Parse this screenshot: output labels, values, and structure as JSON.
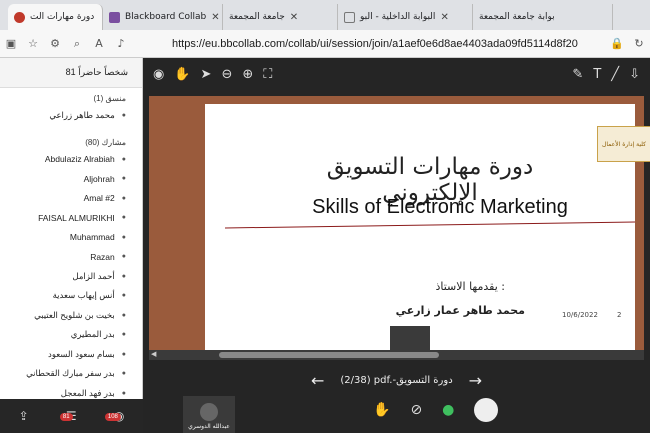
{
  "tabs": [
    {
      "label": "دورة مهارات الت",
      "active": true,
      "color": "#c0392b"
    },
    {
      "label": "Blackboard Collab",
      "active": false,
      "color": "#7b4fa0"
    },
    {
      "label": "جامعة المجمعة",
      "active": false,
      "color": "#2e7d32"
    },
    {
      "label": "البوابة الداخلية - البو",
      "active": false,
      "color": "#999"
    },
    {
      "label": "بوابة جامعة المجمعة",
      "active": false,
      "color": "#999"
    }
  ],
  "address": {
    "url": "https://eu.bbcollab.com/collab/ui/session/join/a1aef0e6d8ae4403ada09fd5114d8f20"
  },
  "sidebar": {
    "header": "81 شخصاً حاضراً",
    "moderator_label": "منسق (1)",
    "moderators": [
      "محمد طاهر زراعي"
    ],
    "participants_label": "مشارك (80)",
    "participants": [
      "Abdulaziz Alrabiah",
      "Aljohrah",
      "Amal #2",
      "FAISAL ALMURIKHI",
      "Muhammad",
      "Razan",
      "أحمد الزامل",
      "أنس إيهاب سعدية",
      "بخيت بن شلويح العتيبي",
      "بدر المطيري",
      "بسام سعود السعود",
      "بدر سفر مبارك القحطاني",
      "بدر فهد المعجل"
    ],
    "footer": {
      "chat_badge": "81",
      "people_badge": "108"
    }
  },
  "slide": {
    "title_ar": "دورة مهارات التسويق الإلكتروني",
    "title_en": "Skills of Electronic Marketing",
    "presenter_label": "يقدمها الاستاذ :",
    "presenter_name": "محمد طاهر عمار زارعي",
    "date": "10/6/2022",
    "page": "2",
    "logo_text": "كلية إدارة الأعمال"
  },
  "slide_nav": {
    "label": "(2/38)  pdf.-دورة التسويق"
  },
  "cam_name": "عبدالله الدوسري"
}
